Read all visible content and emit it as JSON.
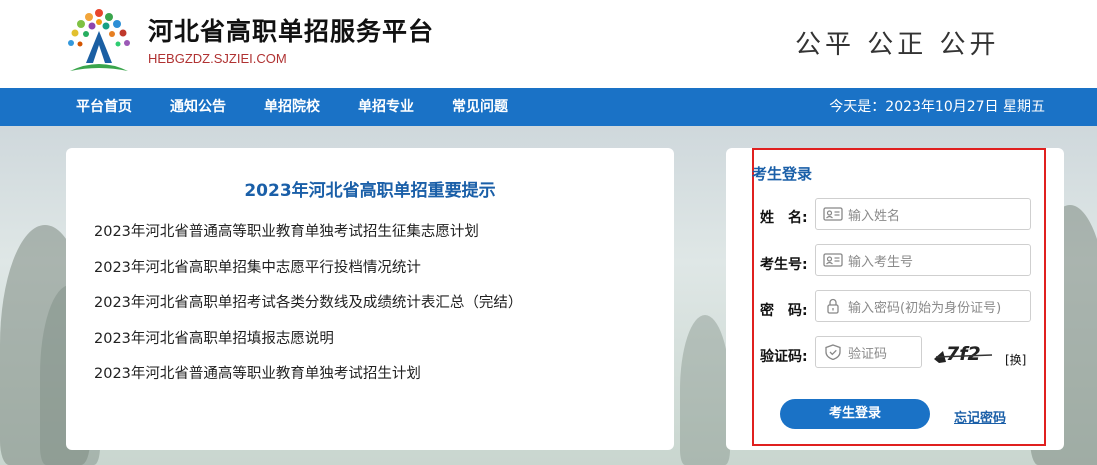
{
  "header": {
    "title": "河北省高职单招服务平台",
    "domain": "HEBGZDZ.SJZIEI.COM",
    "slogan": "公平 公正 公开",
    "logo_icon": "tree-logo-icon"
  },
  "nav": {
    "items": [
      {
        "label": "平台首页"
      },
      {
        "label": "通知公告"
      },
      {
        "label": "单招院校"
      },
      {
        "label": "单招专业"
      },
      {
        "label": "常见问题"
      }
    ],
    "date_text": "今天是：2023年10月27日 星期五"
  },
  "notice": {
    "title": "2023年河北省高职单招重要提示",
    "items": [
      {
        "text": "2023年河北省普通高等职业教育单独考试招生征集志愿计划"
      },
      {
        "text": "2023年河北省高职单招集中志愿平行投档情况统计"
      },
      {
        "text": "2023年河北省高职单招考试各类分数线及成绩统计表汇总（完结）"
      },
      {
        "text": "2023年河北省高职单招填报志愿说明"
      },
      {
        "text": "2023年河北省普通高等职业教育单独考试招生计划"
      }
    ]
  },
  "login": {
    "title": "考生登录",
    "name_label": "姓　名:",
    "name_placeholder": "输入姓名",
    "id_label": "考生号:",
    "id_placeholder": "输入考生号",
    "password_label": "密　码:",
    "password_placeholder": "输入密码(初始为身份证号)",
    "captcha_label": "验证码:",
    "captcha_placeholder": "验证码",
    "captcha_text": "7f2",
    "refresh_label": "[换]",
    "submit_label": "考生登录",
    "forgot_label": "忘记密码"
  },
  "colors": {
    "primary": "#1a72c6",
    "title_blue": "#1a5fa8",
    "highlight_red": "#e0201f",
    "domain_red": "#b03232"
  }
}
